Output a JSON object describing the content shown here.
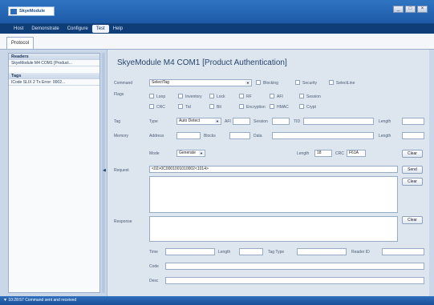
{
  "app": {
    "logo_text": "SkyeModule"
  },
  "window_controls": {
    "minimize": "_",
    "maximize": "□",
    "close": "×"
  },
  "menu": [
    "Host",
    "Demonstrate",
    "Configure",
    "Test",
    "Help"
  ],
  "menu_active_index": 3,
  "tab": {
    "label": "Protocol"
  },
  "sidebar": {
    "readers_title": "Readers",
    "reader_item": "SkyeModule M4 COM1 [Product...",
    "tags_title": "Tags",
    "tag_item": "ICode SLIX 2 Tx Error: 0002..."
  },
  "page_title": "SkyeModule M4 COM1 [Product Authentication]",
  "command": {
    "label": "Command",
    "value": "SelectTag"
  },
  "options": [
    "Blocking",
    "Security",
    "SelectLine"
  ],
  "flags": {
    "label": "Flags",
    "row1": [
      "Loop",
      "Inventory",
      "Lock",
      "RF",
      "AFI",
      "Session"
    ],
    "row2": [
      "CRC",
      "Tid",
      "Bit",
      "Encryption",
      "HMAC",
      "Crypt"
    ]
  },
  "tag": {
    "label": "Tag",
    "type_label": "Type",
    "type_value": "Auto Detect",
    "afi_label": "AFI",
    "session_label": "Session",
    "tid_label": "TID",
    "length_label": "Length"
  },
  "memory": {
    "label": "Memory",
    "address_label": "Address",
    "blocks_label": "Blocks",
    "data_label": "Data",
    "length_label": "Length"
  },
  "mode": {
    "label": "Mode",
    "value": "Generate",
    "length_label": "Length",
    "length_value": "18",
    "crc_label": "CRC",
    "crc_value": "F61A"
  },
  "request": {
    "label": "Request",
    "value": "<02>0C0001001010002<1014>"
  },
  "response": {
    "label": "Response"
  },
  "buttons": {
    "clear": "Clear",
    "send": "Send"
  },
  "response_fields": {
    "time": "Time",
    "length": "Length",
    "tag_type": "Tag Type",
    "reader_id": "Reader ID",
    "code": "Code",
    "desc": "Desc"
  },
  "status": {
    "text": "▼ 10:28:57  Command sent and received"
  }
}
